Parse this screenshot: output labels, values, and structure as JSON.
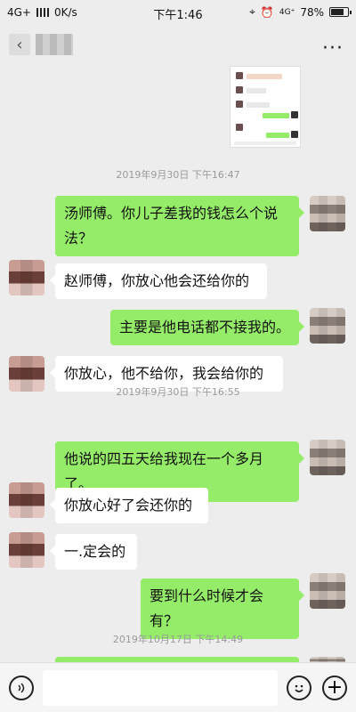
{
  "status_bar": {
    "network": "4G+",
    "speed": "0K/s",
    "time": "下午1:46",
    "net_right": "4G⁺",
    "battery": "78%"
  },
  "nav": {
    "back_icon": "chevron-left-icon",
    "more_icon": "more-dots-icon",
    "more_label": "···"
  },
  "chat": {
    "timestamps": [
      "2019年9月30日 下午16:47",
      "2019年9月30日 下午16:55",
      "2019年10月17日 下午14:49"
    ],
    "messages": [
      {
        "side": "me",
        "text": "汤师傅。你儿子差我的钱怎么个说法？"
      },
      {
        "side": "other",
        "text": "赵师傅，你放心他会还给你的"
      },
      {
        "side": "me",
        "text": "主要是他电话都不接我的。"
      },
      {
        "side": "other",
        "text": "你放心，他不给你，我会给你的"
      },
      {
        "side": "me",
        "text": "他说的四五天给我现在一个多月了。"
      },
      {
        "side": "other",
        "text": "你放心好了会还你的"
      },
      {
        "side": "other",
        "text": "一.定会的"
      },
      {
        "side": "me",
        "text": "要到什么时候才会有？"
      }
    ]
  },
  "input": {
    "voice_icon": "voice-icon",
    "emoji_icon": "emoji-icon",
    "plus_icon": "plus-icon",
    "value": "",
    "plus_label": "+"
  },
  "colors": {
    "me_bubble": "#95ec69",
    "other_bubble": "#ffffff",
    "background": "#ededed"
  }
}
